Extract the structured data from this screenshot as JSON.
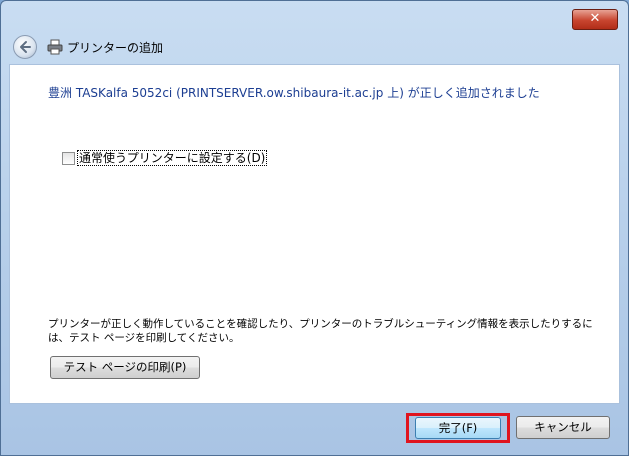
{
  "window": {
    "close_glyph": "✕",
    "title": "プリンターの追加"
  },
  "content": {
    "headline": "豊洲 TASKalfa 5052ci (PRINTSERVER.ow.shibaura-it.ac.jp 上) が正しく追加されました",
    "default_printer_checkbox": {
      "label": "通常使うプリンターに設定する(D)",
      "checked": false
    },
    "description": "プリンターが正しく動作していることを確認したり、プリンターのトラブルシューティング情報を表示したりするには、テスト ページを印刷してください。",
    "test_page_button": "テスト ページの印刷(P)"
  },
  "footer": {
    "finish_button": "完了(F)",
    "cancel_button": "キャンセル"
  },
  "colors": {
    "highlight_border": "#e0141e",
    "headline_text": "#1c3e92"
  },
  "icons": {
    "back": "back-arrow-icon",
    "printer": "printer-icon",
    "close": "close-icon"
  }
}
